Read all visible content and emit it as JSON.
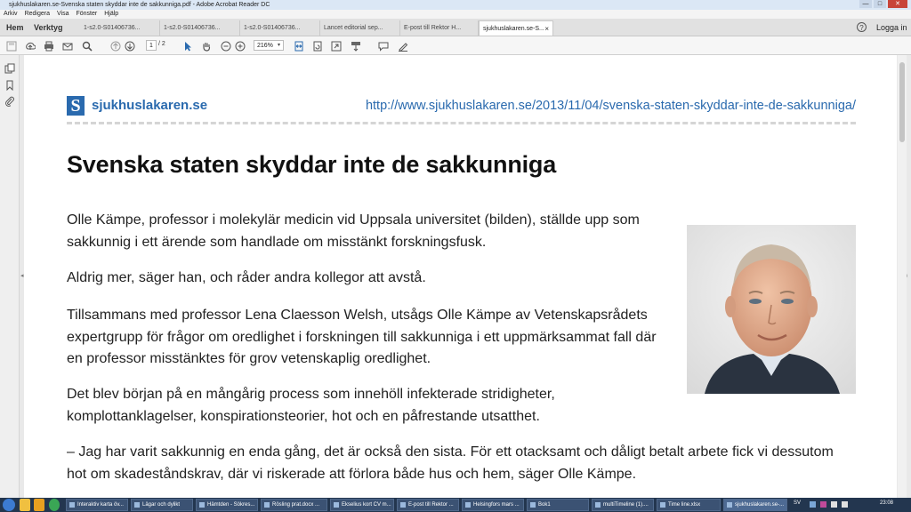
{
  "window": {
    "title": "sjukhuslakaren.se-Svenska staten skyddar inte de sakkunniga.pdf - Adobe Acrobat Reader DC",
    "controls": [
      "—",
      "□",
      "✕"
    ]
  },
  "menu": [
    "Arkiv",
    "Redigera",
    "Visa",
    "Fönster",
    "Hjälp"
  ],
  "nav": {
    "home": "Hem",
    "tools": "Verktyg",
    "help_icon": "?",
    "login": "Logga in"
  },
  "tabs": [
    {
      "label": "1-s2.0-S01406736...",
      "active": false
    },
    {
      "label": "1-s2.0-S01406736...",
      "active": false
    },
    {
      "label": "1-s2.0-S01406736...",
      "active": false
    },
    {
      "label": "Lancet editorial sep...",
      "active": false
    },
    {
      "label": "E-post till Rektor H...",
      "active": false
    },
    {
      "label": "sjukhuslakaren.se-S...",
      "active": true
    }
  ],
  "tab_close": "×",
  "toolbar": {
    "page_current": "1",
    "page_total": "/ 2",
    "zoom": "216%",
    "zoom_arrow": "▾",
    "icons": [
      "save-icon",
      "upload-icon",
      "print-icon",
      "email-icon",
      "search-icon",
      "page-up-icon",
      "page-down-icon",
      "select-cursor-icon",
      "hand-icon",
      "zoom-out-icon",
      "zoom-in-icon",
      "fit-width-icon",
      "rotate-icon",
      "fullscreen-icon",
      "read-mode-icon",
      "comment-icon",
      "sign-icon"
    ]
  },
  "document": {
    "site_name": "sjukhuslakaren.se",
    "logo_letter": "S",
    "url": "http://www.sjukhuslakaren.se/2013/11/04/svenska-staten-skyddar-inte-de-sakkunniga/",
    "title": "Svenska staten skyddar inte de sakkunniga",
    "paragraphs": [
      "Olle Kämpe, professor i molekylär medicin vid Uppsala universitet (bilden), ställde upp som sakkunnig i ett ärende som handlade om misstänkt forskningsfusk.",
      "Aldrig mer, säger han, och råder andra kollegor att avstå.",
      "Tillsammans med professor Lena Claesson Welsh, utsågs Olle Kämpe av Vetenskapsrådets expertgrupp för frågor om oredlighet i forskningen till sakkunniga i ett uppmärksammat fall där en professor misstänktes för grov vetenskaplig oredlighet.",
      "Det blev början på en mångårig process som innehöll infekterade stridigheter, komplottanklagelser, konspirationsteorier, hot och en påfrestande utsatthet.",
      "– Jag har varit sakkunnig en enda gång, det är också den sista. För ett otacksamt och dåligt betalt arbete fick vi dessutom hot om skadeståndskrav, där vi riskerade att förlora både hus och hem, säger Olle Kämpe."
    ]
  },
  "taskbar": {
    "tasks": [
      {
        "label": "Interaktiv karta öv...",
        "active": false
      },
      {
        "label": "Lägar och dylikt",
        "active": false
      },
      {
        "label": "Hämtden - Sökres...",
        "active": false
      },
      {
        "label": "Rösling prat.docx ...",
        "active": false
      },
      {
        "label": "Ekselius kort CV m...",
        "active": false
      },
      {
        "label": "E-post till Rektor ...",
        "active": false
      },
      {
        "label": "Helsingfors mars ...",
        "active": false
      },
      {
        "label": "Bok1",
        "active": false
      },
      {
        "label": "multiTimeline (1)....",
        "active": false
      },
      {
        "label": "Time line.xlsx",
        "active": false
      },
      {
        "label": "sjukhuslakaren.se-...",
        "active": true
      }
    ],
    "tray_label": "SV",
    "clock": "23:08"
  },
  "colors": {
    "link_blue": "#2a6aae",
    "taskbar": "#23364f"
  }
}
